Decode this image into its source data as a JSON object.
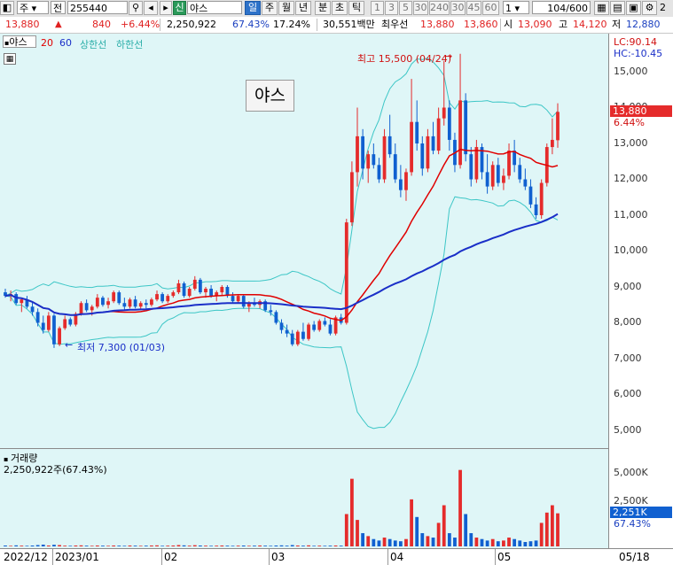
{
  "toolbar": {
    "market_select": "주",
    "type_select": "전",
    "code": "255440",
    "badge": "신",
    "name": "야스",
    "periods": [
      "일",
      "주",
      "월",
      "년",
      "분",
      "초",
      "틱"
    ],
    "intervals": [
      "1",
      "3",
      "5",
      "30",
      "240",
      "30",
      "45",
      "60"
    ],
    "unit_select": "1",
    "count": "104",
    "count_total": "/600",
    "edge_label": "2"
  },
  "quote": {
    "price": "13,880",
    "arrow": "▲",
    "change": "840",
    "change_pct": "+6.44%",
    "volume": "2,250,922",
    "vol_ratio": "67.43%",
    "turnover": "17.24%",
    "amount": "30,551백만",
    "bid_label": "최우선",
    "ask": "13,880",
    "bid": "13,860",
    "open_label": "시",
    "open": "13,090",
    "high_label": "고",
    "high": "14,120",
    "low_label": "저",
    "low": "12,880"
  },
  "price_pane": {
    "legend_name": "야스",
    "ma20_label": "20",
    "ma60_label": "60",
    "upper_label": "상한선",
    "lower_label": "하한선",
    "stock_title": "야스",
    "high_annot": "최고 15,500 (04/24)",
    "low_annot": "최저 7,300 (01/03)",
    "lc_label": "LC:90.14",
    "hc_label": "HC:-10.45",
    "price_tag": "13,880",
    "pct_tag": "6.44%",
    "y_ticks": [
      "15,000",
      "14,000",
      "13,000",
      "12,000",
      "11,000",
      "10,000",
      "9,000",
      "8,000",
      "7,000",
      "6,000",
      "5,000"
    ]
  },
  "volume_pane": {
    "title": "거래량",
    "value": "2,250,922주(67.43%)",
    "y_ticks": [
      "5,000K",
      "2,500K"
    ],
    "vol_tag": "2,251K",
    "vol_pct": "67.43%"
  },
  "xaxis": {
    "labels": [
      "2022/12",
      "2023/01",
      "02",
      "03",
      "04",
      "05",
      "05/18"
    ]
  },
  "colors": {
    "up": "#e52b2b",
    "down": "#1060d0",
    "ma20": "#e00000",
    "ma60": "#1a2fc8",
    "band": "#3cc6c6",
    "pane_bg": "#dff6f7"
  },
  "chart_data": {
    "type": "candlestick",
    "x_range": [
      "2022/12",
      "05/18"
    ],
    "ylim": [
      4700,
      15800
    ],
    "candles_ohlc": [
      [
        8850,
        8950,
        8700,
        8750
      ],
      [
        8750,
        8900,
        8600,
        8800
      ],
      [
        8800,
        8850,
        8500,
        8550
      ],
      [
        8550,
        8700,
        8300,
        8650
      ],
      [
        8650,
        8750,
        8400,
        8450
      ],
      [
        8450,
        8600,
        8200,
        8300
      ],
      [
        8300,
        8400,
        7900,
        8000
      ],
      [
        8000,
        8200,
        7700,
        7800
      ],
      [
        7800,
        8300,
        7750,
        8200
      ],
      [
        8200,
        8250,
        7300,
        7400
      ],
      [
        7400,
        7900,
        7350,
        7850
      ],
      [
        7850,
        8200,
        7800,
        8100
      ],
      [
        8100,
        8150,
        7900,
        7950
      ],
      [
        7950,
        8300,
        7900,
        8250
      ],
      [
        8250,
        8600,
        8200,
        8550
      ],
      [
        8550,
        8650,
        8300,
        8350
      ],
      [
        8350,
        8500,
        8200,
        8450
      ],
      [
        8450,
        8800,
        8400,
        8700
      ],
      [
        8700,
        8750,
        8450,
        8500
      ],
      [
        8500,
        8700,
        8400,
        8600
      ],
      [
        8600,
        8900,
        8550,
        8850
      ],
      [
        8850,
        8900,
        8500,
        8550
      ],
      [
        8550,
        8700,
        8350,
        8450
      ],
      [
        8450,
        8700,
        8400,
        8650
      ],
      [
        8650,
        8750,
        8400,
        8450
      ],
      [
        8450,
        8600,
        8350,
        8550
      ],
      [
        8550,
        8650,
        8400,
        8500
      ],
      [
        8500,
        8700,
        8450,
        8650
      ],
      [
        8650,
        8900,
        8600,
        8800
      ],
      [
        8800,
        8850,
        8550,
        8600
      ],
      [
        8600,
        8800,
        8550,
        8750
      ],
      [
        8750,
        8900,
        8700,
        8850
      ],
      [
        8850,
        9200,
        8800,
        9100
      ],
      [
        9100,
        9150,
        8700,
        8750
      ],
      [
        8750,
        9000,
        8700,
        8950
      ],
      [
        8950,
        9300,
        8900,
        9200
      ],
      [
        9200,
        9250,
        8800,
        8850
      ],
      [
        8850,
        9000,
        8700,
        8950
      ],
      [
        8950,
        9050,
        8700,
        8750
      ],
      [
        8750,
        8900,
        8600,
        8850
      ],
      [
        8850,
        9050,
        8750,
        9000
      ],
      [
        9000,
        9050,
        8700,
        8750
      ],
      [
        8750,
        8850,
        8550,
        8600
      ],
      [
        8600,
        8800,
        8550,
        8750
      ],
      [
        8750,
        8800,
        8400,
        8450
      ],
      [
        8450,
        8600,
        8300,
        8550
      ],
      [
        8550,
        8700,
        8450,
        8500
      ],
      [
        8500,
        8650,
        8400,
        8600
      ],
      [
        8600,
        8650,
        8300,
        8350
      ],
      [
        8350,
        8500,
        8200,
        8300
      ],
      [
        8300,
        8350,
        7950,
        8000
      ],
      [
        8000,
        8100,
        7700,
        7800
      ],
      [
        7800,
        7950,
        7600,
        7700
      ],
      [
        7700,
        7800,
        7350,
        7400
      ],
      [
        7400,
        7800,
        7350,
        7750
      ],
      [
        7750,
        8000,
        7500,
        7550
      ],
      [
        7550,
        8000,
        7500,
        7950
      ],
      [
        7950,
        8050,
        7750,
        7800
      ],
      [
        7800,
        8100,
        7750,
        8050
      ],
      [
        8050,
        8150,
        7900,
        7950
      ],
      [
        7950,
        8100,
        7650,
        7700
      ],
      [
        7700,
        8200,
        7650,
        8150
      ],
      [
        8150,
        8250,
        7950,
        8000
      ],
      [
        8000,
        10900,
        7950,
        10800
      ],
      [
        10800,
        12500,
        10700,
        12200
      ],
      [
        12200,
        14000,
        11800,
        13200
      ],
      [
        13200,
        13400,
        12000,
        12300
      ],
      [
        12300,
        12800,
        11900,
        12700
      ],
      [
        12700,
        13000,
        12300,
        12400
      ],
      [
        12400,
        12600,
        11900,
        12000
      ],
      [
        12000,
        13400,
        11900,
        13200
      ],
      [
        13200,
        13800,
        12600,
        12700
      ],
      [
        12700,
        13000,
        11900,
        12000
      ],
      [
        12000,
        12400,
        11500,
        11700
      ],
      [
        11700,
        12300,
        11400,
        12200
      ],
      [
        12200,
        14800,
        12100,
        13600
      ],
      [
        13600,
        14200,
        12800,
        13000
      ],
      [
        13000,
        13200,
        12100,
        12300
      ],
      [
        12300,
        13400,
        12200,
        13200
      ],
      [
        13200,
        13600,
        12700,
        12800
      ],
      [
        12800,
        14000,
        12700,
        13700
      ],
      [
        13700,
        15300,
        13500,
        14000
      ],
      [
        14000,
        14200,
        12800,
        13100
      ],
      [
        13100,
        13300,
        12200,
        12400
      ],
      [
        12400,
        15500,
        12300,
        14200
      ],
      [
        14200,
        14400,
        12500,
        12700
      ],
      [
        12700,
        12900,
        11800,
        12000
      ],
      [
        12000,
        13100,
        11900,
        12900
      ],
      [
        12900,
        13000,
        12000,
        12200
      ],
      [
        12200,
        12700,
        11600,
        11800
      ],
      [
        11800,
        12500,
        11700,
        12400
      ],
      [
        12400,
        12600,
        11800,
        11900
      ],
      [
        11900,
        12300,
        11700,
        12100
      ],
      [
        12100,
        13000,
        12000,
        12800
      ],
      [
        12800,
        13100,
        12200,
        12400
      ],
      [
        12400,
        12600,
        11900,
        12000
      ],
      [
        12000,
        12300,
        11700,
        11800
      ],
      [
        11800,
        12000,
        11200,
        11300
      ],
      [
        11300,
        11500,
        10900,
        11000
      ],
      [
        11000,
        12000,
        10900,
        11900
      ],
      [
        11900,
        13000,
        11800,
        12900
      ],
      [
        12900,
        13700,
        12700,
        13100
      ],
      [
        13090,
        14120,
        12880,
        13880
      ]
    ],
    "volume_k": [
      60,
      40,
      70,
      50,
      40,
      60,
      90,
      120,
      60,
      110,
      90,
      50,
      40,
      60,
      70,
      50,
      40,
      60,
      50,
      40,
      60,
      50,
      40,
      60,
      50,
      40,
      50,
      60,
      70,
      40,
      50,
      60,
      90,
      70,
      50,
      80,
      60,
      50,
      40,
      50,
      60,
      50,
      40,
      50,
      60,
      40,
      50,
      60,
      50,
      40,
      60,
      70,
      50,
      90,
      60,
      50,
      70,
      40,
      50,
      40,
      50,
      60,
      50,
      2200,
      4600,
      1800,
      900,
      700,
      500,
      400,
      600,
      500,
      400,
      350,
      500,
      3200,
      2000,
      900,
      700,
      600,
      1600,
      2800,
      900,
      600,
      5200,
      2200,
      900,
      600,
      500,
      400,
      500,
      350,
      400,
      600,
      500,
      400,
      300,
      350,
      400,
      1600,
      2300,
      2800,
      2251
    ]
  }
}
